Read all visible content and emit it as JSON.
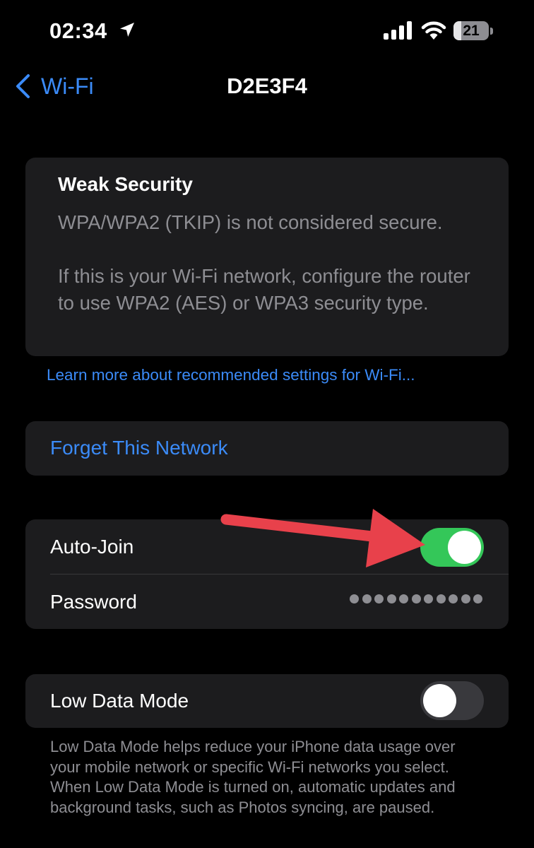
{
  "status_bar": {
    "time": "02:34",
    "battery_level": "21",
    "battery_fraction": 0.21,
    "icons": [
      "location-arrow-icon",
      "cellular-signal-icon",
      "wifi-icon",
      "battery-icon"
    ]
  },
  "nav": {
    "back_label": "Wi-Fi",
    "title": "D2E3F4"
  },
  "security": {
    "title": "Weak Security",
    "line1": "WPA/WPA2 (TKIP) is not considered secure.",
    "line2": "If this is your Wi-Fi network, configure the router to use WPA2 (AES) or WPA3 security type."
  },
  "learn_link": "Learn more about recommended settings for Wi-Fi...",
  "forget_label": "Forget This Network",
  "auto_join": {
    "label": "Auto-Join",
    "enabled": true
  },
  "password": {
    "label": "Password",
    "masked_length": 11
  },
  "low_data": {
    "label": "Low Data Mode",
    "enabled": false
  },
  "footer_note": "Low Data Mode helps reduce your iPhone data usage over your mobile network or specific Wi-Fi networks you select. When Low Data Mode is turned on, automatic updates and background tasks, such as Photos syncing, are paused.",
  "colors": {
    "accent": "#3b8bf8",
    "toggle_on": "#34c759",
    "toggle_off": "#39393d",
    "annotation_arrow": "#e8414b",
    "card_bg": "#1c1c1e"
  }
}
